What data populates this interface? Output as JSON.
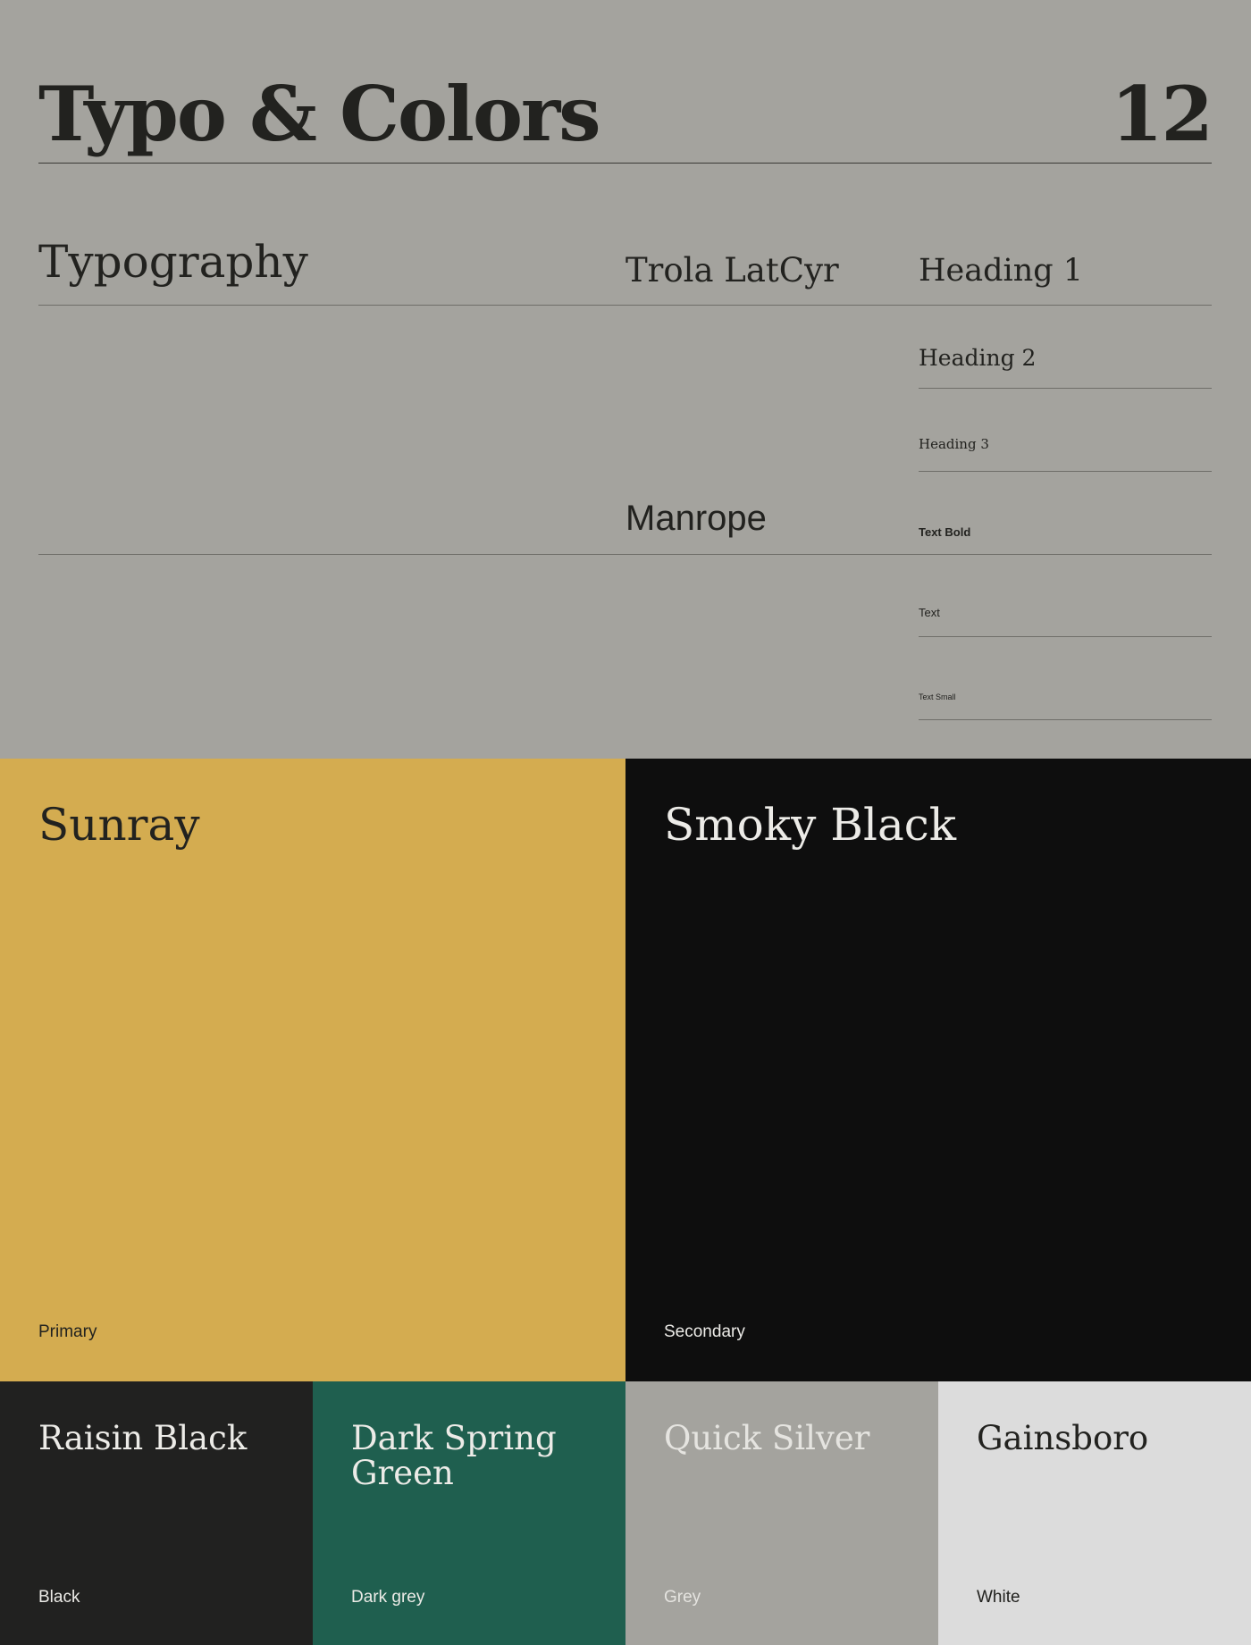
{
  "header": {
    "title": "Typo & Colors",
    "page_number": "12"
  },
  "typography": {
    "section_title": "Typography",
    "fonts": [
      "Trola LatCyr",
      "Manrope"
    ],
    "styles": [
      "Heading 1",
      "Heading 2",
      "Heading 3",
      "Text Bold",
      "Text",
      "Text Small"
    ]
  },
  "colors": {
    "primary": {
      "name": "Sunray",
      "role": "Primary",
      "hex": "#d4ac50"
    },
    "secondary": {
      "name": "Smoky Black",
      "role": "Secondary",
      "hex": "#0e0e0e"
    },
    "palette": [
      {
        "name": "Raisin Black",
        "role": "Black",
        "hex": "#212120"
      },
      {
        "name": "Dark Spring Green",
        "role": "Dark grey",
        "hex": "#1f5f4f"
      },
      {
        "name": "Quick Silver",
        "role": "Grey",
        "hex": "#a4a39e"
      },
      {
        "name": "Gainsboro",
        "role": "White",
        "hex": "#dcdcdc"
      }
    ]
  }
}
